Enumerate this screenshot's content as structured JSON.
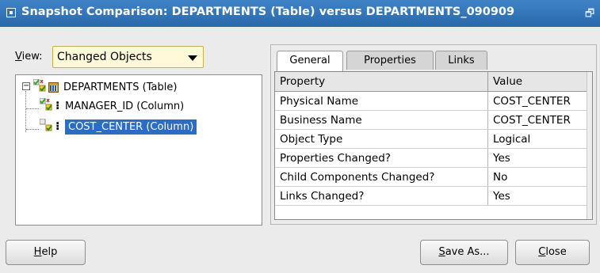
{
  "window": {
    "title": "Snapshot Comparison: DEPARTMENTS (Table) versus DEPARTMENTS_090909"
  },
  "view": {
    "label_mnemonic": "V",
    "label_rest": "iew:",
    "selected": "Changed Objects"
  },
  "tree": {
    "root": {
      "label": "DEPARTMENTS (Table)"
    },
    "children": [
      {
        "label": "MANAGER_ID (Column)"
      },
      {
        "label": "COST_CENTER (Column)"
      }
    ]
  },
  "tabs": [
    {
      "label": "General"
    },
    {
      "label": "Properties"
    },
    {
      "label": "Links"
    }
  ],
  "grid": {
    "headers": [
      "Property",
      "Value"
    ],
    "rows": [
      [
        "Physical Name",
        "COST_CENTER"
      ],
      [
        "Business Name",
        "COST_CENTER"
      ],
      [
        "Object Type",
        "Logical"
      ],
      [
        "Properties Changed?",
        "Yes"
      ],
      [
        "Child Components Changed?",
        "No"
      ],
      [
        "Links Changed?",
        "Yes"
      ]
    ]
  },
  "buttons": {
    "help": {
      "mnemonic": "H",
      "rest": "elp"
    },
    "save_as": {
      "mnemonic": "S",
      "rest": "ave As..."
    },
    "close": {
      "mnemonic": "C",
      "rest": "lose"
    }
  },
  "colors": {
    "titlebar": "#3f83c6",
    "selection": "#2b6cc4",
    "dropdown_bg": "#fff9d9"
  }
}
